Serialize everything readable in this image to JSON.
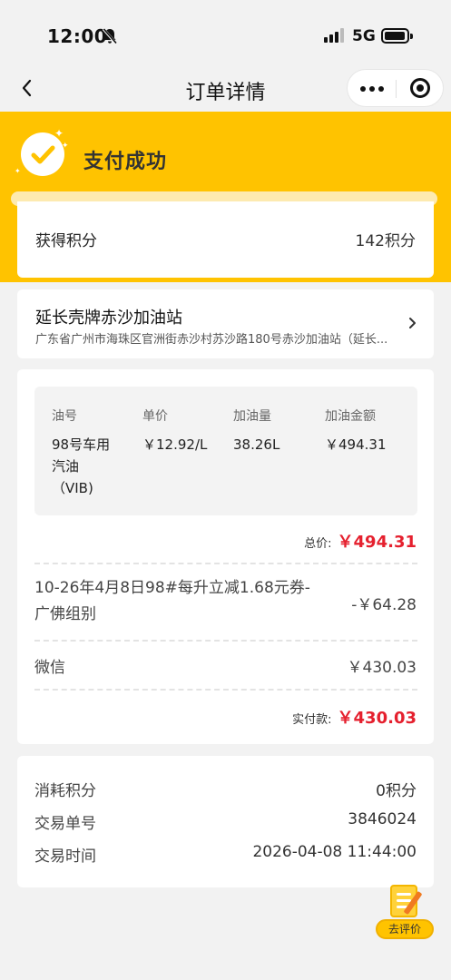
{
  "status_bar": {
    "time": "12:00",
    "network": "5G"
  },
  "nav": {
    "title": "订单详情"
  },
  "banner": {
    "status": "支付成功"
  },
  "points": {
    "label": "获得积分",
    "value": "142积分"
  },
  "station": {
    "name": "延长壳牌赤沙加油站",
    "address": "广东省广州市海珠区官洲街赤沙村苏沙路180号赤沙加油站（延长..."
  },
  "fuel": {
    "headers": [
      "油号",
      "单价",
      "加油量",
      "加油金额"
    ],
    "values": {
      "grade_lines": [
        "98号车用",
        "汽油",
        "（VIB)"
      ],
      "unit_price": "￥12.92/L",
      "volume": "38.26L",
      "amount": "￥494.31"
    }
  },
  "totals": {
    "total_label": "总价:",
    "total_amount": "￥494.31",
    "coupon_text": "10-26年4月8日98#每升立减1.68元券-广佛组别",
    "coupon_amount": "-￥64.28",
    "payment_method": "微信",
    "payment_amount": "￥430.03",
    "paid_label": "实付款:",
    "paid_amount": "￥430.03"
  },
  "info": {
    "points_used_label": "消耗积分",
    "points_used_value": "0积分",
    "txn_id_label": "交易单号",
    "txn_id_value": "3846024",
    "txn_time_label": "交易时间",
    "txn_time_value": "2026-04-08 11:44:00"
  },
  "review": {
    "label": "去评价"
  },
  "colors": {
    "brand_yellow": "#ffc300",
    "price_red": "#e5202e",
    "background": "#f2f2f2"
  },
  "icons": [
    "bell-mute-icon",
    "signal-icon",
    "battery-icon",
    "back-chevron-icon",
    "more-dots-icon",
    "close-ring-icon",
    "check-circle-icon",
    "chevron-right-icon",
    "review-pen-icon"
  ]
}
